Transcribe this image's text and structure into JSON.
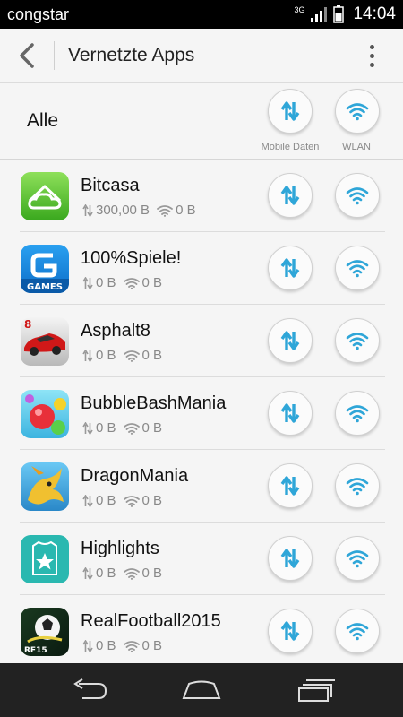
{
  "status_bar": {
    "carrier": "congstar",
    "network_type": "3G",
    "time": "14:04"
  },
  "header": {
    "title": "Vernetzte Apps"
  },
  "all_row": {
    "label": "Alle",
    "mobile_label": "Mobile Daten",
    "wlan_label": "WLAN"
  },
  "apps": [
    {
      "name": "Bitcasa",
      "mobile": "300,00 B",
      "wlan": "0 B",
      "icon": "bitcasa-icon"
    },
    {
      "name": "100%Spiele!",
      "mobile": "0 B",
      "wlan": "0 B",
      "icon": "gameloft-games-icon"
    },
    {
      "name": "Asphalt8",
      "mobile": "0 B",
      "wlan": "0 B",
      "icon": "asphalt8-icon"
    },
    {
      "name": "BubbleBashMania",
      "mobile": "0 B",
      "wlan": "0 B",
      "icon": "bubblebashmania-icon"
    },
    {
      "name": "DragonMania",
      "mobile": "0 B",
      "wlan": "0 B",
      "icon": "dragonmania-icon"
    },
    {
      "name": "Highlights",
      "mobile": "0 B",
      "wlan": "0 B",
      "icon": "highlights-icon"
    },
    {
      "name": "RealFootball2015",
      "mobile": "0 B",
      "wlan": "0 B",
      "icon": "realfootball2015-icon"
    }
  ],
  "colors": {
    "accent": "#2fa6d8",
    "statusbar": "#000000",
    "navbar": "#222222",
    "background": "#f5f5f5"
  },
  "icons": {
    "mobile_toggle": "mobile-data-arrows-icon",
    "wlan_toggle": "wifi-icon",
    "back": "chevron-left-icon",
    "menu": "overflow-menu-icon",
    "nav": [
      "back-nav-icon",
      "home-nav-icon",
      "recents-nav-icon"
    ]
  }
}
